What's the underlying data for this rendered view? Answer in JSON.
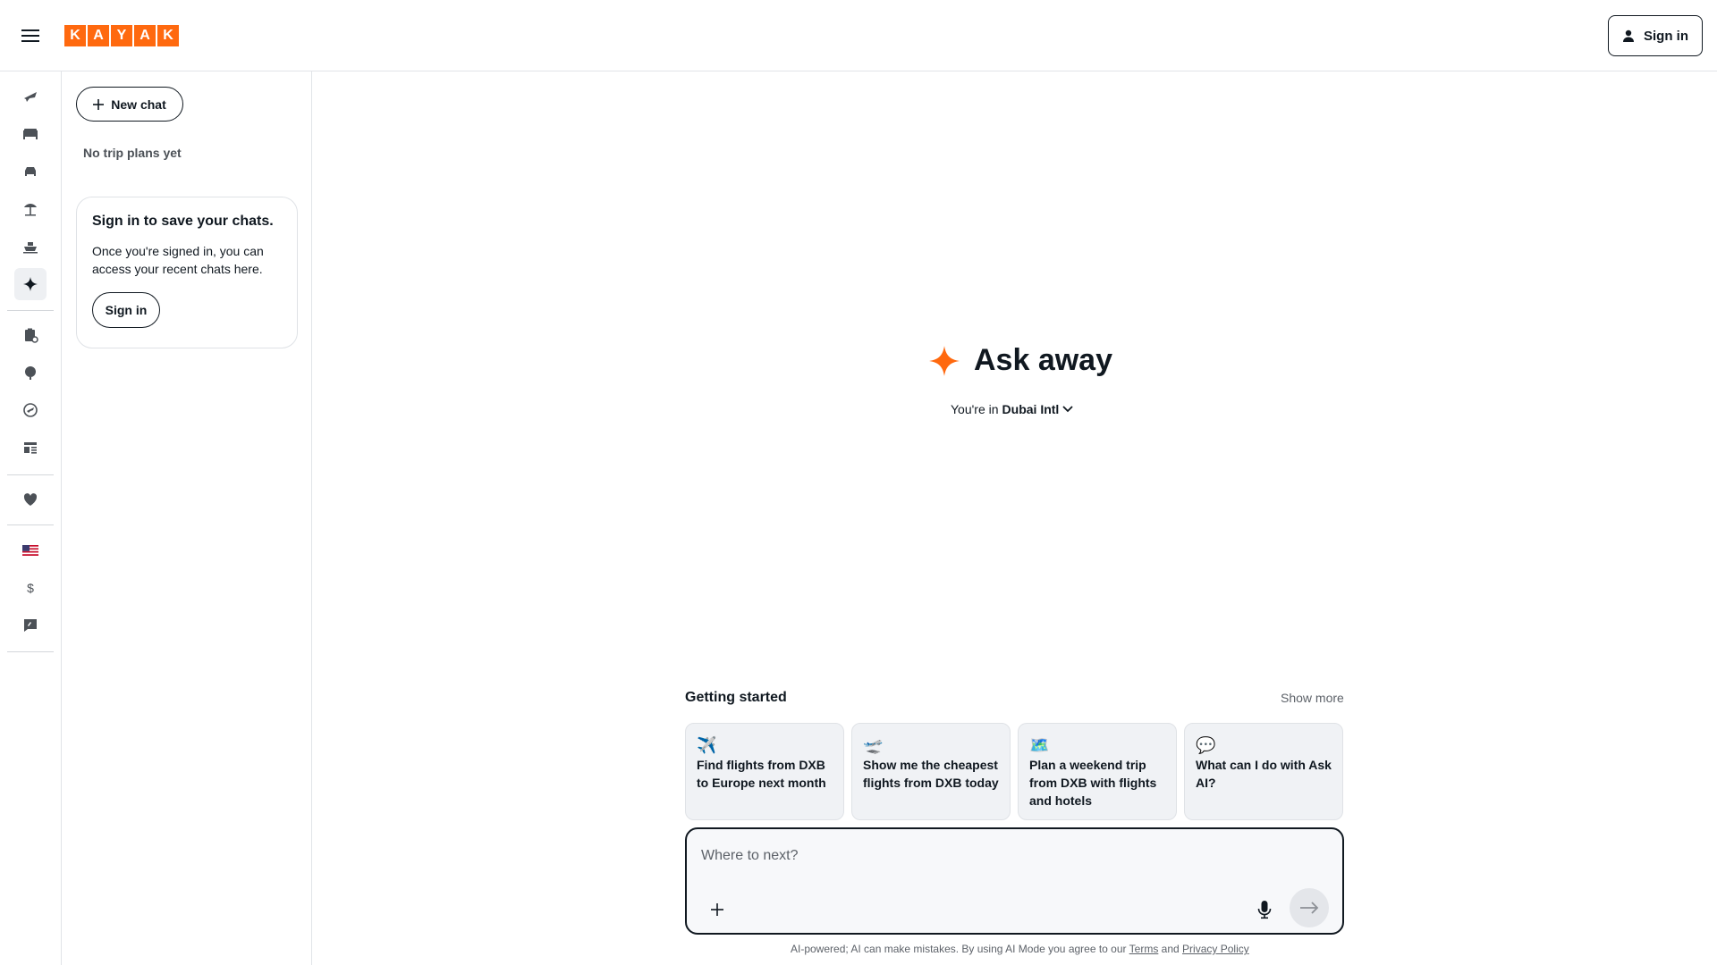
{
  "header": {
    "logo_letters": [
      "K",
      "A",
      "Y",
      "A",
      "K"
    ],
    "signin_label": "Sign in"
  },
  "rail": {
    "items": [
      {
        "icon": "flights-icon",
        "label": "Flights"
      },
      {
        "icon": "stays-icon",
        "label": "Stays"
      },
      {
        "icon": "cars-icon",
        "label": "Cars"
      },
      {
        "icon": "packages-icon",
        "label": "Packages"
      },
      {
        "icon": "cruises-icon",
        "label": "Cruises"
      },
      {
        "icon": "ai-sparkle-icon",
        "label": "AI Mode",
        "active": true
      },
      {
        "icon": "trips-icon",
        "label": "Trips"
      },
      {
        "icon": "explore-icon",
        "label": "Explore"
      },
      {
        "icon": "flight-tracker-icon",
        "label": "Flight Tracker"
      },
      {
        "icon": "business-icon",
        "label": "Business"
      },
      {
        "icon": "heart-icon",
        "label": "Saved"
      },
      {
        "icon": "us-flag-icon",
        "label": "Language"
      },
      {
        "icon": "dollar-icon",
        "label": "$"
      },
      {
        "icon": "feedback-icon",
        "label": "Feedback"
      }
    ],
    "currency_symbol": "$"
  },
  "panel": {
    "new_chat_label": "New chat",
    "no_trips_text": "No trip plans yet",
    "card": {
      "title": "Sign in to save your chats.",
      "body": "Once you're signed in, you can access your recent chats here.",
      "button": "Sign in"
    }
  },
  "main": {
    "title": "Ask away",
    "location_prefix": "You're in",
    "location_value": "Dubai Intl",
    "getting_started": "Getting started",
    "show_more": "Show more",
    "suggestions": [
      {
        "emoji": "✈️",
        "text": "Find flights from DXB to Europe next month"
      },
      {
        "emoji": "🛫",
        "text": "Show me the cheapest flights from DXB today"
      },
      {
        "emoji": "🗺️",
        "text": "Plan a weekend trip from DXB with flights and hotels"
      },
      {
        "emoji": "💬",
        "text": "What can I do with Ask AI?"
      }
    ],
    "composer_placeholder": "Where to next?",
    "disclaimer_prefix": "AI-powered; AI can make mistakes. By using AI Mode you agree to our",
    "terms_label": "Terms",
    "and_label": "and",
    "privacy_label": "Privacy Policy"
  },
  "colors": {
    "brand": "#ff690f",
    "text": "#101820",
    "muted": "#5d6269",
    "card_bg": "#f0f2f5"
  }
}
